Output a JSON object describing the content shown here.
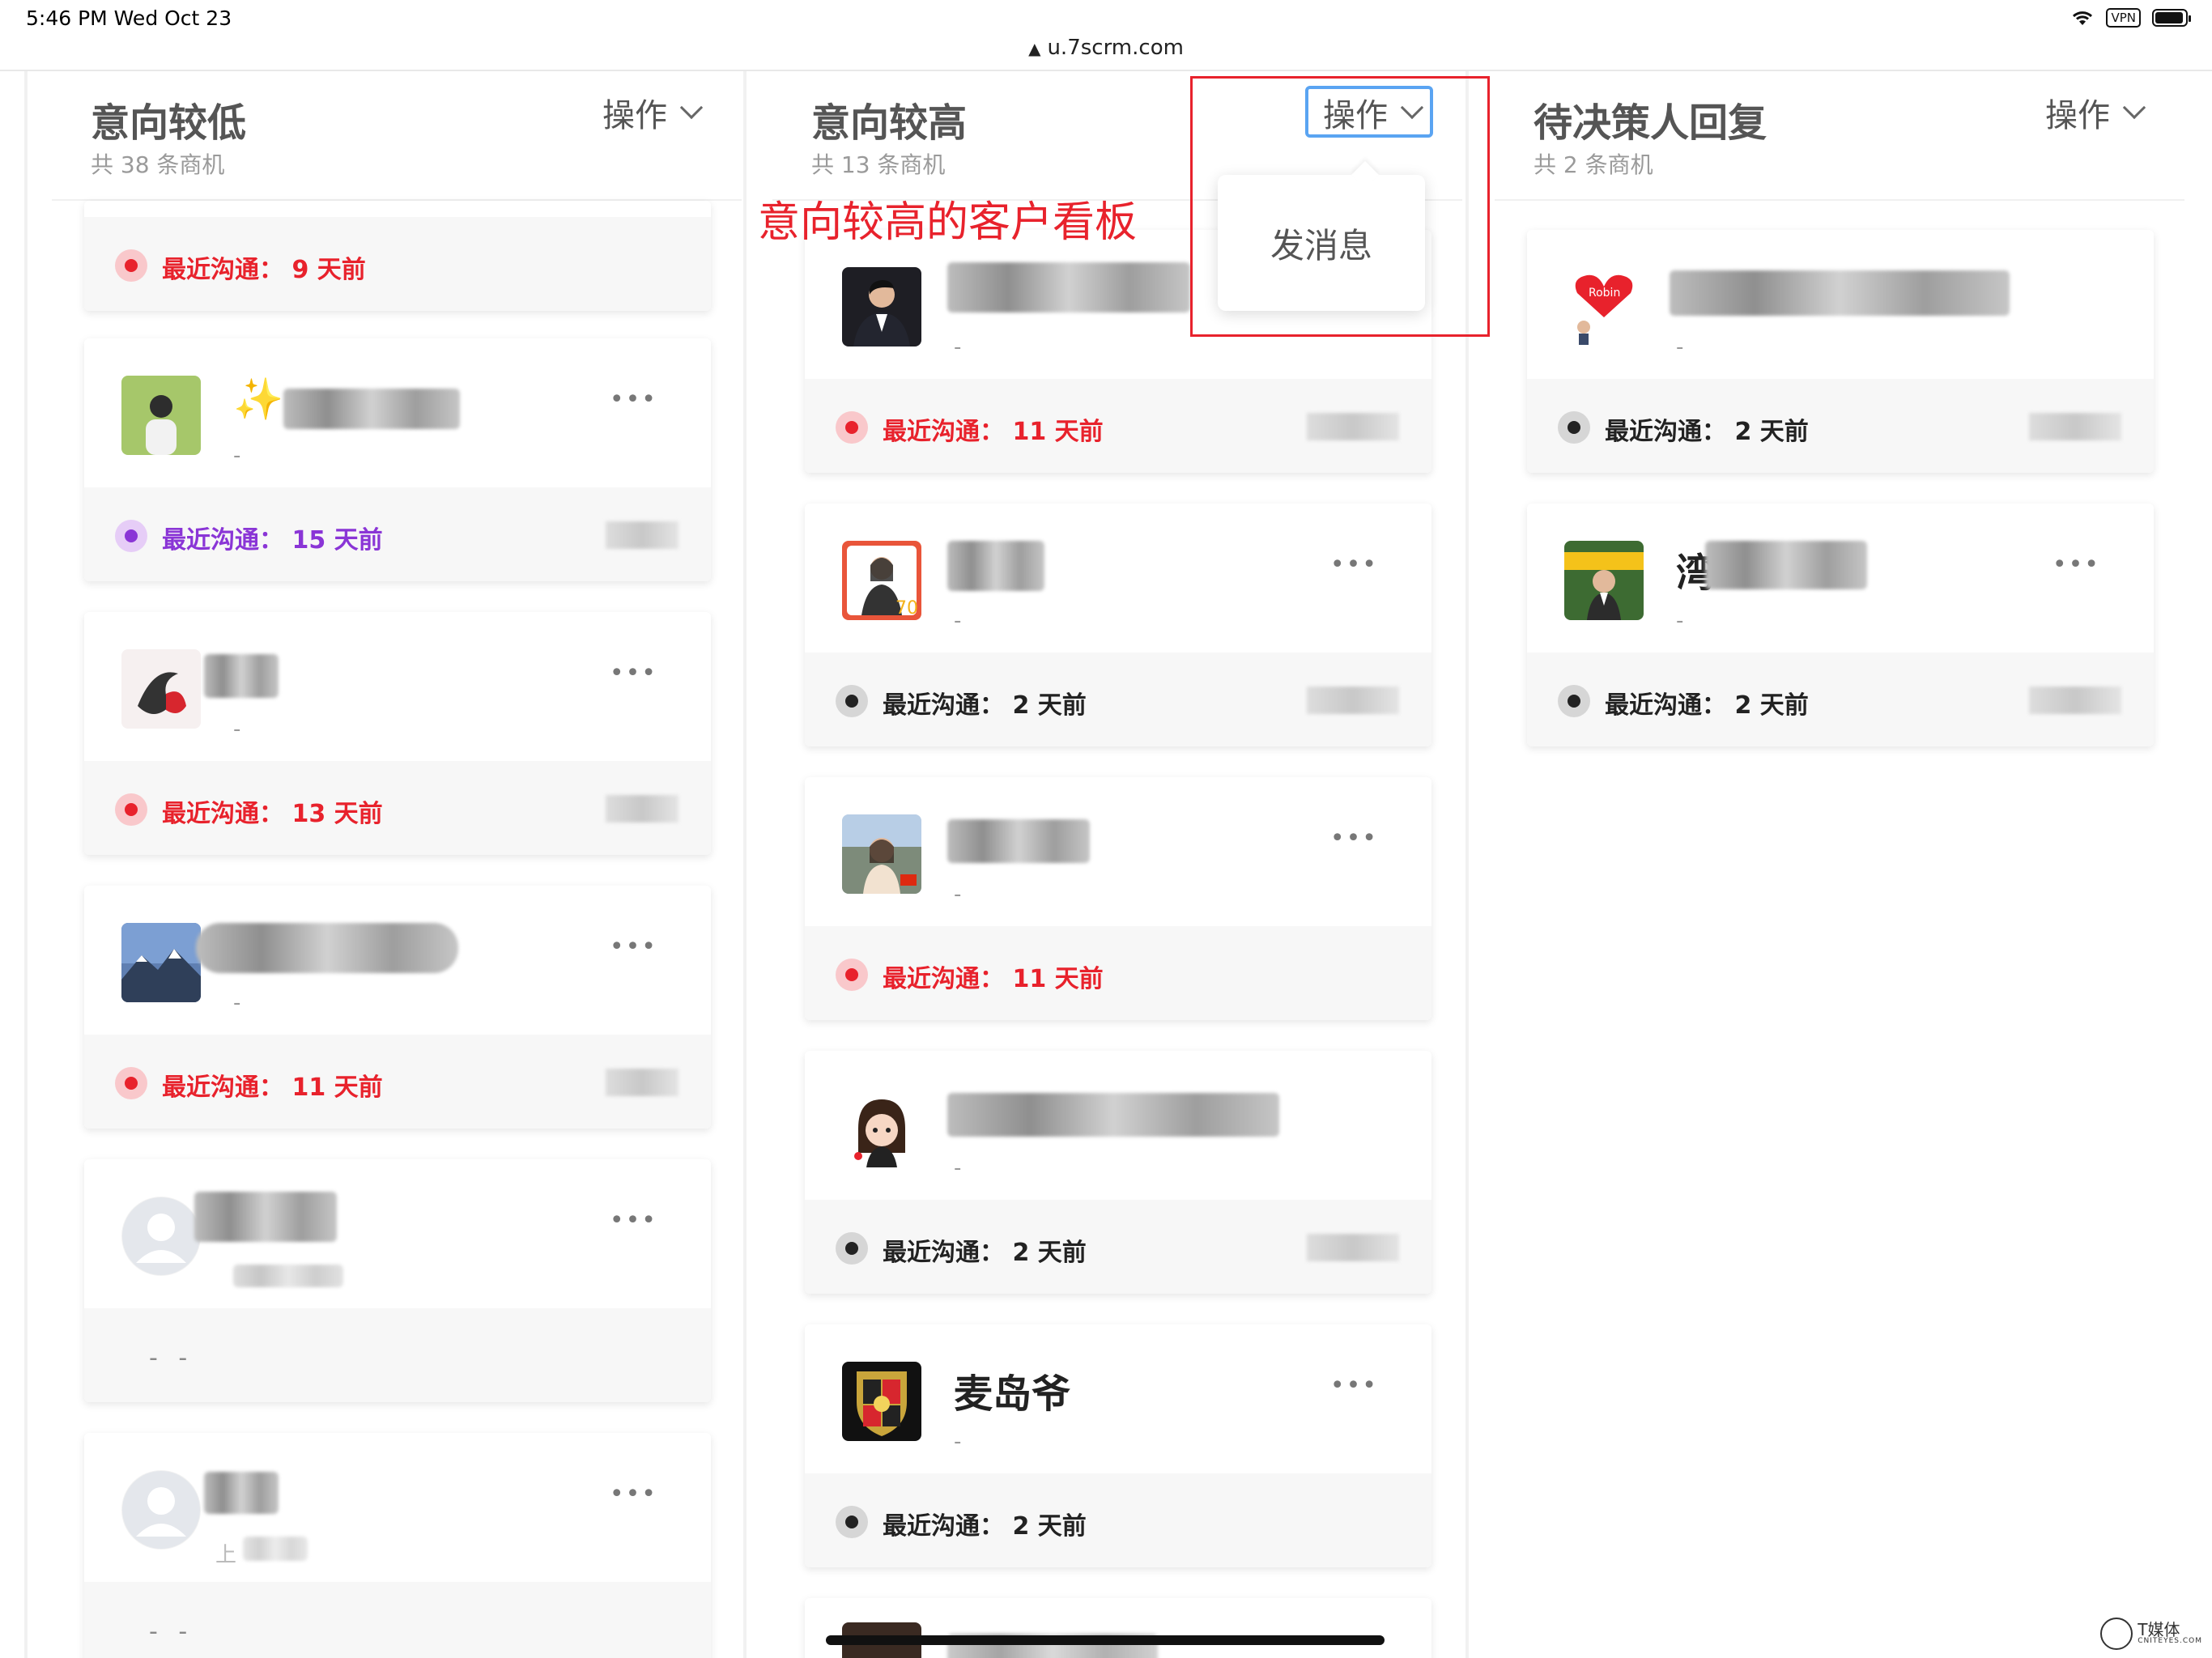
{
  "status": {
    "time_date": "5:46 PM   Wed Oct 23",
    "vpn": "VPN"
  },
  "browser": {
    "url": "u.7scrm.com"
  },
  "annotation": {
    "text": "意向较高的客户看板"
  },
  "dropdown": {
    "item": "发消息"
  },
  "columns": [
    {
      "title": "意向较低",
      "count": "共 38 条商机",
      "op": "操作",
      "cards": [
        {
          "name": "",
          "sub": "",
          "status": "最近沟通：  9 天前",
          "status_color": "#e8222c"
        },
        {
          "name": "✨",
          "sub": "-",
          "status": "最近沟通：  15 天前",
          "status_color": "#8a35d6"
        },
        {
          "name": "",
          "sub": "-",
          "status": "最近沟通：  13 天前",
          "status_color": "#e8222c"
        },
        {
          "name": "",
          "sub": "-",
          "status": "最近沟通：  11 天前",
          "status_color": "#e8222c"
        },
        {
          "name": "",
          "sub": "",
          "status": "- -"
        },
        {
          "name": "",
          "sub": "上",
          "status": "- -"
        }
      ]
    },
    {
      "title": "意向较高",
      "count": "共 13 条商机",
      "op": "操作",
      "cards": [
        {
          "name": "",
          "sub": "-",
          "status": "最近沟通：  11 天前",
          "status_color": "#e8222c"
        },
        {
          "name": "",
          "sub": "-",
          "status": "最近沟通：  2 天前",
          "status_color": "#222222"
        },
        {
          "name": "",
          "sub": "-",
          "status": "最近沟通：  11 天前",
          "status_color": "#e8222c"
        },
        {
          "name": "",
          "sub": "-",
          "status": "最近沟通：  2 天前",
          "status_color": "#222222"
        },
        {
          "name": "麦岛爷",
          "sub": "-",
          "status": "最近沟通：  2 天前",
          "status_color": "#222222"
        }
      ]
    },
    {
      "title": "待决策人回复",
      "count": "共 2 条商机",
      "op": "操作",
      "cards": [
        {
          "name": "",
          "sub": "-",
          "status": "最近沟通：  2 天前",
          "status_color": "#222222"
        },
        {
          "name": "湾",
          "sub": "-",
          "status": "最近沟通：  2 天前",
          "status_color": "#222222"
        }
      ]
    }
  ],
  "more_icon": "ellipsis-icon",
  "watermark": {
    "name": "T媒体",
    "site": "CNITEYES.COM"
  }
}
